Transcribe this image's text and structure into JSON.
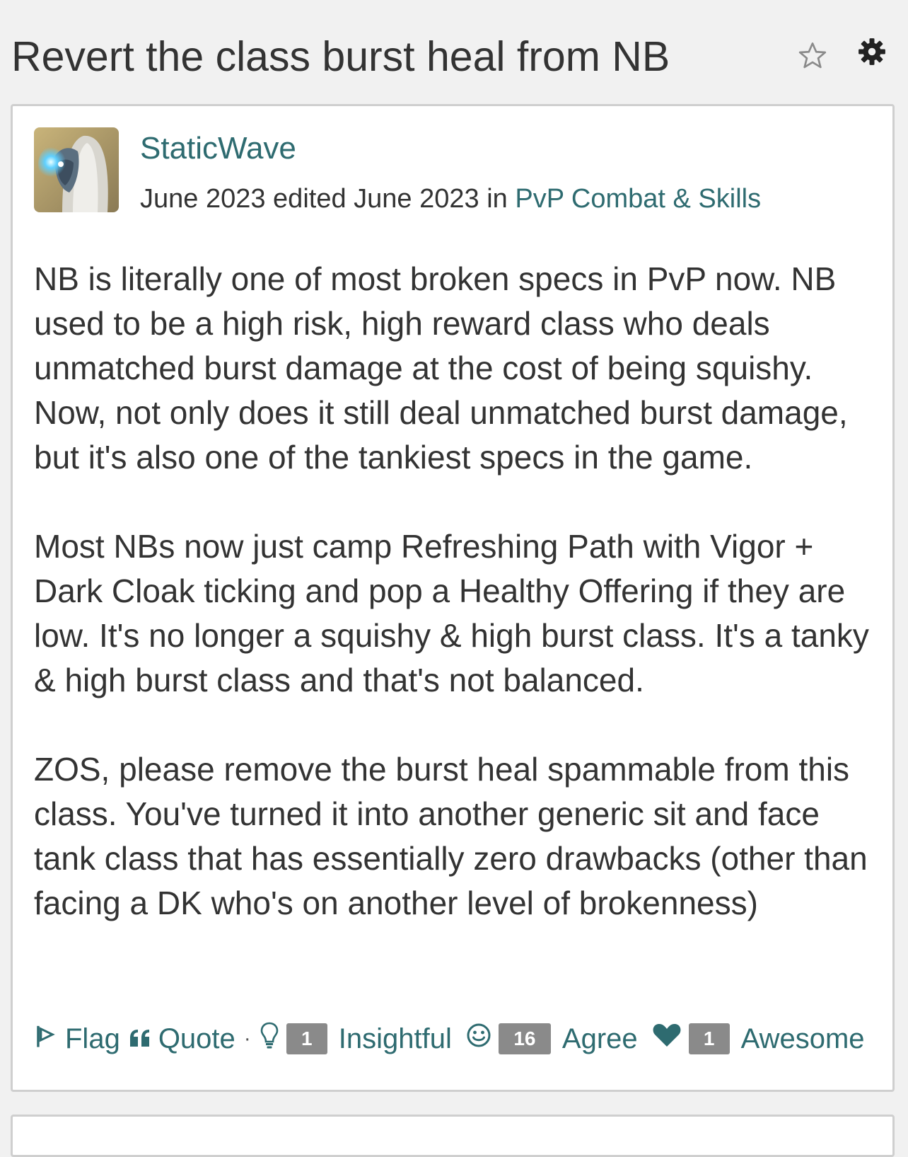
{
  "header": {
    "title": "Revert the class burst heal from NB",
    "bookmark_icon": "star-outline-icon",
    "options_icon": "gear-icon"
  },
  "post": {
    "author": "StaticWave",
    "date_text": "June 2023 edited June 2023 in ",
    "category": "PvP Combat & Skills",
    "paragraphs": [
      "NB is literally one of most broken specs in PvP now. NB used to be a high risk, high reward class who deals unmatched burst damage at the cost of being squishy. Now, not only does it still deal unmatched burst damage, but it's also one of the tankiest specs in the game.",
      "Most NBs now just camp Refreshing Path with Vigor + Dark Cloak ticking and pop a Healthy Offering if they are low. It's no longer a squishy & high burst class. It's a tanky & high burst class and that's not balanced.",
      "ZOS, please remove the burst heal spammable from this class. You've turned it into another generic sit and face tank class that has essentially zero drawbacks (other than facing a DK who's on another level of brokenness)"
    ],
    "actions": {
      "flag": "Flag",
      "quote": "Quote",
      "separator": "·"
    },
    "reactions": [
      {
        "icon": "lightbulb-icon",
        "count": "1",
        "label": "Insightful"
      },
      {
        "icon": "smiley-icon",
        "count": "16",
        "label": "Agree"
      },
      {
        "icon": "heart-icon",
        "count": "1",
        "label": "Awesome"
      }
    ]
  },
  "colors": {
    "link": "#2e6b70",
    "text": "#333333",
    "badge": "#8a8a8a",
    "border": "#cfcfcf",
    "background": "#f1f1f1"
  }
}
